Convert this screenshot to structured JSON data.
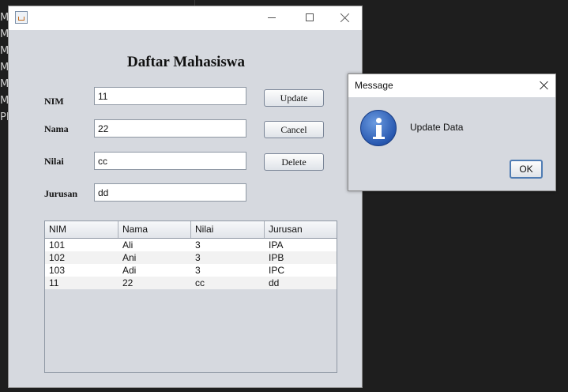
{
  "background": {
    "side_letters": [
      "M",
      "M",
      "M",
      "M",
      "M",
      "M",
      "PM"
    ]
  },
  "main_window": {
    "form_title": "Daftar Mahasiswa",
    "fields": [
      {
        "label": "NIM",
        "value": "11"
      },
      {
        "label": "Nama",
        "value": "22"
      },
      {
        "label": "Nilai",
        "value": "cc"
      },
      {
        "label": "Jurusan",
        "value": "dd"
      }
    ],
    "buttons": {
      "update": "Update",
      "cancel": "Cancel",
      "delete": "Delete"
    },
    "table": {
      "columns": [
        "NIM",
        "Nama",
        "Nilai",
        "Jurusan"
      ],
      "rows": [
        [
          "101",
          "Ali",
          "3",
          "IPA"
        ],
        [
          "102",
          "Ani",
          "3",
          "IPB"
        ],
        [
          "103",
          "Adi",
          "3",
          "IPC"
        ],
        [
          "11",
          "22",
          "cc",
          "dd"
        ]
      ]
    }
  },
  "dialog": {
    "title": "Message",
    "message": "Update Data",
    "ok_label": "OK",
    "icon": "info-icon"
  },
  "colors": {
    "window_bg": "#d6d9df",
    "row_alt": "#f2f2f2",
    "info_blue": "#2858b0"
  }
}
